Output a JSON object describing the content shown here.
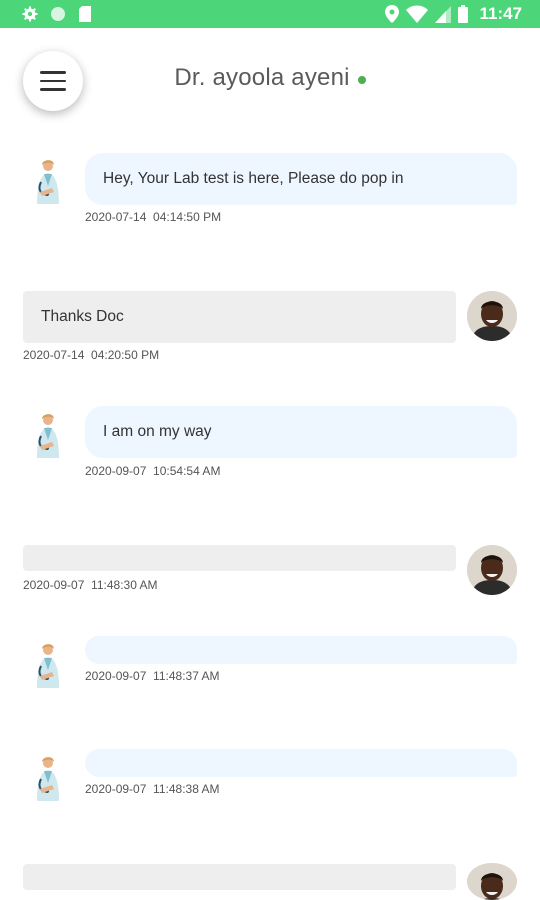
{
  "status_bar": {
    "icons_left": [
      "settings-icon",
      "circle-icon",
      "sd-card-icon"
    ],
    "icons_right": [
      "location-icon",
      "wifi-icon",
      "signal-icon",
      "battery-icon"
    ],
    "time": "11:47"
  },
  "header": {
    "menu_icon": "hamburger-menu-icon",
    "title": "Dr. ayoola ayeni",
    "status_color": "#4caf50"
  },
  "colors": {
    "status_bar": "#4cd679",
    "incoming_bubble": "#eef6ff",
    "outgoing_bubble": "#eeeeee"
  },
  "messages": [
    {
      "sender": "doctor",
      "text": "Hey, Your Lab test is here, Please do pop in",
      "timestamp": "2020-07-14  04:14:50 PM"
    },
    {
      "sender": "user",
      "text": "Thanks Doc",
      "timestamp": "2020-07-14  04:20:50 PM"
    },
    {
      "sender": "doctor",
      "text": "I am on my way",
      "timestamp": "2020-09-07  10:54:54 AM"
    },
    {
      "sender": "user",
      "text": "",
      "timestamp": "2020-09-07  11:48:30 AM"
    },
    {
      "sender": "doctor",
      "text": "",
      "timestamp": "2020-09-07  11:48:37 AM"
    },
    {
      "sender": "doctor",
      "text": "",
      "timestamp": "2020-09-07  11:48:38 AM"
    },
    {
      "sender": "user",
      "text": "",
      "timestamp": ""
    }
  ]
}
